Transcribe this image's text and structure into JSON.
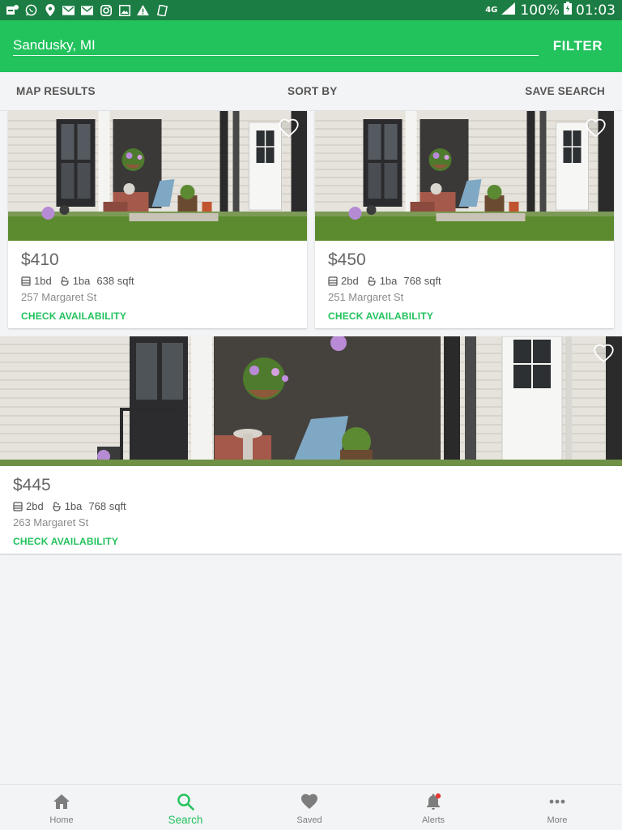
{
  "status_bar": {
    "network": "4G",
    "battery": "100%",
    "time": "01:03"
  },
  "search": {
    "location_value": "Sandusky, MI",
    "filter_label": "FILTER"
  },
  "toolbar": {
    "map_results_label": "MAP RESULTS",
    "sort_by_label": "SORT BY",
    "save_search_label": "SAVE SEARCH"
  },
  "listings": [
    {
      "price": "$410",
      "beds": "1bd",
      "baths": "1ba",
      "sqft": "638 sqft",
      "address": "257 Margaret St",
      "cta": "CHECK AVAILABILITY"
    },
    {
      "price": "$450",
      "beds": "2bd",
      "baths": "1ba",
      "sqft": "768 sqft",
      "address": "251 Margaret St",
      "cta": "CHECK AVAILABILITY"
    },
    {
      "price": "$445",
      "beds": "2bd",
      "baths": "1ba",
      "sqft": "768 sqft",
      "address": "263 Margaret St",
      "cta": "CHECK AVAILABILITY"
    }
  ],
  "bottom_nav": {
    "items": [
      {
        "label": "Home",
        "icon": "home-icon"
      },
      {
        "label": "Search",
        "icon": "search-icon",
        "active": true
      },
      {
        "label": "Saved",
        "icon": "heart-icon"
      },
      {
        "label": "Alerts",
        "icon": "bell-icon"
      },
      {
        "label": "More",
        "icon": "more-icon"
      }
    ]
  },
  "colors": {
    "brand_green": "#22c25d",
    "status_bar": "#1b7d43",
    "alert_dot": "#e53935"
  }
}
